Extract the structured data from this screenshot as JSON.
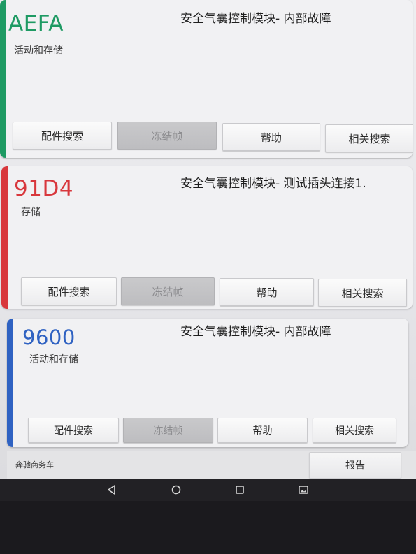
{
  "colors": {
    "card1_accent": "#1e9a63",
    "card2_accent": "#d8373c",
    "card3_accent": "#2f62c2",
    "code1": "#1e9a63",
    "code2": "#d8373c",
    "code3": "#2f62c2"
  },
  "cards": [
    {
      "code": "AEFA",
      "status": "活动和存储",
      "description": "安全气囊控制模块- 内部故障",
      "buttons": {
        "parts": "配件搜索",
        "freeze": "冻结帧",
        "help": "帮助",
        "related": "相关搜索"
      }
    },
    {
      "code": "91D4",
      "status": "存储",
      "description": "安全气囊控制模块- 测试插头连接1.",
      "buttons": {
        "parts": "配件搜索",
        "freeze": "冻结帧",
        "help": "帮助",
        "related": "相关搜索"
      }
    },
    {
      "code": "9600",
      "status": "活动和存储",
      "description": "安全气囊控制模块- 内部故障",
      "buttons": {
        "parts": "配件搜索",
        "freeze": "冻结帧",
        "help": "帮助",
        "related": "相关搜索"
      }
    }
  ],
  "footer": {
    "vehicle": "奔驰商务车",
    "report_label": "报告"
  },
  "navbar": {
    "icons": [
      "back-icon",
      "home-icon",
      "recents-icon",
      "screenshot-icon"
    ]
  }
}
